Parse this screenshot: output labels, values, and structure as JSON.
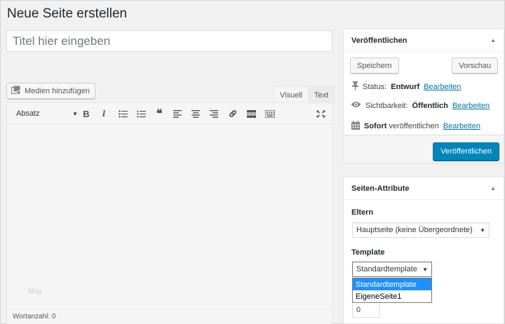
{
  "page": {
    "title": "Neue Seite erstellen"
  },
  "title_field": {
    "placeholder": "Titel hier eingeben",
    "value": ""
  },
  "media": {
    "label": "Medien hinzufügen",
    "icon": "media-icon"
  },
  "editor": {
    "tabs": [
      {
        "label": "Visuell",
        "active": true
      },
      {
        "label": "Text",
        "active": false
      }
    ],
    "format_select": "Absatz",
    "toolbar_icons": [
      "bold-icon",
      "italic-icon",
      "bullet-list-icon",
      "numbered-list-icon",
      "blockquote-icon",
      "align-left-icon",
      "align-center-icon",
      "align-right-icon",
      "link-icon",
      "more-tag-icon",
      "toolbar-toggle-icon",
      "fullscreen-icon"
    ],
    "toolbar_glyphs": {
      "bold": "B",
      "italic": "I"
    },
    "watermark": "blog",
    "word_count": "Wortanzahl: 0"
  },
  "publish": {
    "title": "Veröffentlichen",
    "save_label": "Speichern",
    "preview_label": "Vorschau",
    "status_label": "Status:",
    "status_value": "Entwurf",
    "visibility_label": "Sichtbarkeit:",
    "visibility_value": "Öffentlich",
    "schedule_bold": "Sofort",
    "schedule_text": "veröffentlichen",
    "edit_link": "Bearbeiten",
    "publish_label": "Veröffentlichen",
    "accent_color": "#0085ba",
    "link_color": "#0073aa"
  },
  "attributes": {
    "title": "Seiten-Attribute",
    "parent_label": "Eltern",
    "parent_value": "Hauptseite (keine Übergeordnete)",
    "template_label": "Template",
    "template_value": "Standardtemplate",
    "template_options": [
      "Standardtemplate",
      "EigeneSeite1"
    ],
    "template_selected_index": 0,
    "order_value": "0"
  }
}
